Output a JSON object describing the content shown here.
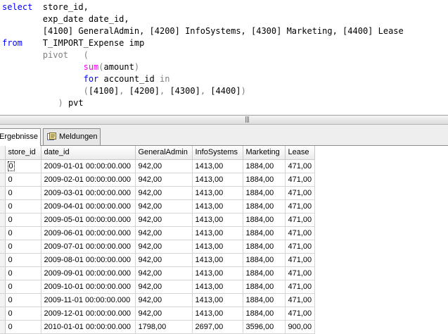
{
  "editor": {
    "lines": [
      [
        {
          "t": "select",
          "c": "kw"
        },
        {
          "t": "  store_id,",
          "c": ""
        }
      ],
      [
        {
          "t": "        exp_date date_id,",
          "c": ""
        }
      ],
      [
        {
          "t": "        [4100] GeneralAdmin, [4200] InfoSystems, [4300] Marketing, [4400] Lease",
          "c": ""
        }
      ],
      [
        {
          "t": "from",
          "c": "kw"
        },
        {
          "t": "    T_IMPORT_Expense imp",
          "c": ""
        }
      ],
      [
        {
          "t": "        ",
          "c": ""
        },
        {
          "t": "pivot   (",
          "c": "op"
        }
      ],
      [
        {
          "t": "                ",
          "c": ""
        },
        {
          "t": "sum",
          "c": "fn"
        },
        {
          "t": "(",
          "c": "op"
        },
        {
          "t": "amount",
          "c": ""
        },
        {
          "t": ")",
          "c": "op"
        }
      ],
      [
        {
          "t": "                ",
          "c": ""
        },
        {
          "t": "for",
          "c": "kw"
        },
        {
          "t": " account_id ",
          "c": ""
        },
        {
          "t": "in",
          "c": "op"
        }
      ],
      [
        {
          "t": "                ",
          "c": ""
        },
        {
          "t": "(",
          "c": "op"
        },
        {
          "t": "[4100]",
          "c": ""
        },
        {
          "t": ", ",
          "c": "op"
        },
        {
          "t": "[4200]",
          "c": ""
        },
        {
          "t": ", ",
          "c": "op"
        },
        {
          "t": "[4300]",
          "c": ""
        },
        {
          "t": ", ",
          "c": "op"
        },
        {
          "t": "[4400]",
          "c": ""
        },
        {
          "t": ")",
          "c": "op"
        }
      ],
      [
        {
          "t": "           ",
          "c": ""
        },
        {
          "t": ")",
          "c": "op"
        },
        {
          "t": " pvt",
          "c": ""
        }
      ]
    ]
  },
  "splitter": {
    "grip": "|||"
  },
  "tabs": {
    "results_label": "Ergebnisse",
    "messages_label": "Meldungen"
  },
  "grid": {
    "columns": [
      "store_id",
      "date_id",
      "GeneralAdmin",
      "InfoSystems",
      "Marketing",
      "Lease"
    ],
    "rows": [
      [
        "0",
        "2009-01-01 00:00:00.000",
        "942,00",
        "1413,00",
        "1884,00",
        "471,00"
      ],
      [
        "0",
        "2009-02-01 00:00:00.000",
        "942,00",
        "1413,00",
        "1884,00",
        "471,00"
      ],
      [
        "0",
        "2009-03-01 00:00:00.000",
        "942,00",
        "1413,00",
        "1884,00",
        "471,00"
      ],
      [
        "0",
        "2009-04-01 00:00:00.000",
        "942,00",
        "1413,00",
        "1884,00",
        "471,00"
      ],
      [
        "0",
        "2009-05-01 00:00:00.000",
        "942,00",
        "1413,00",
        "1884,00",
        "471,00"
      ],
      [
        "0",
        "2009-06-01 00:00:00.000",
        "942,00",
        "1413,00",
        "1884,00",
        "471,00"
      ],
      [
        "0",
        "2009-07-01 00:00:00.000",
        "942,00",
        "1413,00",
        "1884,00",
        "471,00"
      ],
      [
        "0",
        "2009-08-01 00:00:00.000",
        "942,00",
        "1413,00",
        "1884,00",
        "471,00"
      ],
      [
        "0",
        "2009-09-01 00:00:00.000",
        "942,00",
        "1413,00",
        "1884,00",
        "471,00"
      ],
      [
        "0",
        "2009-10-01 00:00:00.000",
        "942,00",
        "1413,00",
        "1884,00",
        "471,00"
      ],
      [
        "0",
        "2009-11-01 00:00:00.000",
        "942,00",
        "1413,00",
        "1884,00",
        "471,00"
      ],
      [
        "0",
        "2009-12-01 00:00:00.000",
        "942,00",
        "1413,00",
        "1884,00",
        "471,00"
      ],
      [
        "0",
        "2010-01-01 00:00:00.000",
        "1798,00",
        "2697,00",
        "3596,00",
        "900,00"
      ]
    ]
  }
}
